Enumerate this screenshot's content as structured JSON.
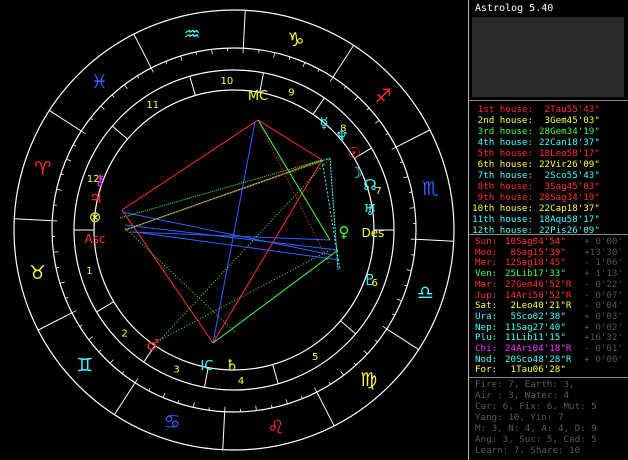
{
  "app": {
    "title": "Astrolog 5.40"
  },
  "wheel": {
    "house_numbers": [
      "1",
      "2",
      "3",
      "4",
      "5",
      "6",
      "7",
      "8",
      "9",
      "10",
      "11",
      "12"
    ],
    "angle_labels": {
      "mc": "MC",
      "ic": "IC",
      "asc": "Asc",
      "des": "Des"
    },
    "colors": {
      "ring": "#ffffff",
      "fire": "#ff2020",
      "earth": "#ffff30",
      "air": "#20ffff",
      "water": "#3060ff",
      "mixed": "#20ff20"
    }
  },
  "houses": [
    {
      "label": "1st house:",
      "value": " 2Tau55'43\"",
      "color": "#ff3030"
    },
    {
      "label": "2nd house:",
      "value": " 3Gem45'03\"",
      "color": "#ffff30"
    },
    {
      "label": "3rd house:",
      "value": "28Gem34'19\"",
      "color": "#40ff40"
    },
    {
      "label": "4th house:",
      "value": "22Can18'37\"",
      "color": "#40ffff"
    },
    {
      "label": "5th house:",
      "value": "18Leo58'17\"",
      "color": "#ff3030"
    },
    {
      "label": "6th house:",
      "value": "22Vir26'09\"",
      "color": "#ffff30"
    },
    {
      "label": "7th house:",
      "value": " 2Sco55'43\"",
      "color": "#40ffff"
    },
    {
      "label": "8th house:",
      "value": " 3Sag45'03\"",
      "color": "#ff3030"
    },
    {
      "label": "9th house:",
      "value": "28Sag34'19\"",
      "color": "#ff3030"
    },
    {
      "label": "10th house:",
      "value": "22Cap18'37\"",
      "color": "#ffff30"
    },
    {
      "label": "11th house:",
      "value": "18Aqu58'17\"",
      "color": "#40ffff"
    },
    {
      "label": "12th house:",
      "value": "22Pis26'09\"",
      "color": "#40ffff"
    }
  ],
  "planets": [
    {
      "label": "Sun:",
      "value": "10Sag04'54\"",
      "speed": "+ 0'00'",
      "color": "#ff3030"
    },
    {
      "label": "Moo:",
      "value": " 8Sag15'39\"",
      "speed": "+13'30'",
      "color": "#ff3030"
    },
    {
      "label": "Mer:",
      "value": "12Sag18'45\"",
      "speed": "- 1'06'",
      "color": "#ff3030"
    },
    {
      "label": "Ven:",
      "value": "25Lib17'33\"",
      "speed": "+ 1'13'",
      "color": "#40ff40"
    },
    {
      "label": "Mar:",
      "value": "27Gem46'52\"R",
      "speed": "- 0'22'",
      "color": "#ff3030"
    },
    {
      "label": "Jup:",
      "value": "14Ari50'52\"R",
      "speed": "- 0'07'",
      "color": "#ff3030"
    },
    {
      "label": "Sat:",
      "value": " 2Leo40'21\"R",
      "speed": "- 0'04'",
      "color": "#ffff30"
    },
    {
      "label": "Ura:",
      "value": " 5Sco02'38\"",
      "speed": "+ 0'03'",
      "color": "#40ffff"
    },
    {
      "label": "Nep:",
      "value": "11Sag27'40\"",
      "speed": "+ 0'02'",
      "color": "#40ffff"
    },
    {
      "label": "Plu:",
      "value": "11Lib11'15\"",
      "speed": "+16'32'",
      "color": "#40ffff"
    },
    {
      "label": "Chi:",
      "value": "24Ari04'18\"R",
      "speed": "- 0'01'",
      "color": "#ff30ff"
    },
    {
      "label": "Nod:",
      "value": "20Sco48'28\"R",
      "speed": "+ 0'00'",
      "color": "#40ffff"
    },
    {
      "label": "For:",
      "value": " 1Tau06'28\"",
      "speed": "",
      "color": "#ffff30"
    }
  ],
  "summary": [
    "Fire: 7, Earth: 3,",
    "Air : 3, Water: 4",
    "Car: 6, Fix: 6, Mut: 5",
    "Yang: 10, Yin: 7",
    "M: 3, N: 4, A: 4, D: 9",
    "Ang: 3, Suc: 5, Cad: 5",
    "Learn: 7, Share: 10"
  ]
}
